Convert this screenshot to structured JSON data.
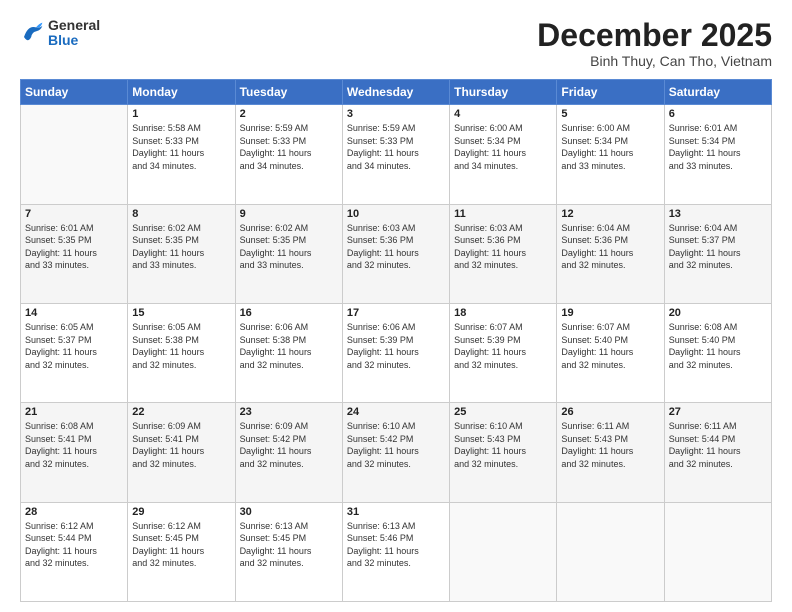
{
  "header": {
    "logo": {
      "general": "General",
      "blue": "Blue"
    },
    "title": "December 2025",
    "subtitle": "Binh Thuy, Can Tho, Vietnam"
  },
  "weekdays": [
    "Sunday",
    "Monday",
    "Tuesday",
    "Wednesday",
    "Thursday",
    "Friday",
    "Saturday"
  ],
  "weeks": [
    [
      {
        "day": "",
        "info": ""
      },
      {
        "day": "1",
        "info": "Sunrise: 5:58 AM\nSunset: 5:33 PM\nDaylight: 11 hours\nand 34 minutes."
      },
      {
        "day": "2",
        "info": "Sunrise: 5:59 AM\nSunset: 5:33 PM\nDaylight: 11 hours\nand 34 minutes."
      },
      {
        "day": "3",
        "info": "Sunrise: 5:59 AM\nSunset: 5:33 PM\nDaylight: 11 hours\nand 34 minutes."
      },
      {
        "day": "4",
        "info": "Sunrise: 6:00 AM\nSunset: 5:34 PM\nDaylight: 11 hours\nand 34 minutes."
      },
      {
        "day": "5",
        "info": "Sunrise: 6:00 AM\nSunset: 5:34 PM\nDaylight: 11 hours\nand 33 minutes."
      },
      {
        "day": "6",
        "info": "Sunrise: 6:01 AM\nSunset: 5:34 PM\nDaylight: 11 hours\nand 33 minutes."
      }
    ],
    [
      {
        "day": "7",
        "info": "Sunrise: 6:01 AM\nSunset: 5:35 PM\nDaylight: 11 hours\nand 33 minutes."
      },
      {
        "day": "8",
        "info": "Sunrise: 6:02 AM\nSunset: 5:35 PM\nDaylight: 11 hours\nand 33 minutes."
      },
      {
        "day": "9",
        "info": "Sunrise: 6:02 AM\nSunset: 5:35 PM\nDaylight: 11 hours\nand 33 minutes."
      },
      {
        "day": "10",
        "info": "Sunrise: 6:03 AM\nSunset: 5:36 PM\nDaylight: 11 hours\nand 32 minutes."
      },
      {
        "day": "11",
        "info": "Sunrise: 6:03 AM\nSunset: 5:36 PM\nDaylight: 11 hours\nand 32 minutes."
      },
      {
        "day": "12",
        "info": "Sunrise: 6:04 AM\nSunset: 5:36 PM\nDaylight: 11 hours\nand 32 minutes."
      },
      {
        "day": "13",
        "info": "Sunrise: 6:04 AM\nSunset: 5:37 PM\nDaylight: 11 hours\nand 32 minutes."
      }
    ],
    [
      {
        "day": "14",
        "info": "Sunrise: 6:05 AM\nSunset: 5:37 PM\nDaylight: 11 hours\nand 32 minutes."
      },
      {
        "day": "15",
        "info": "Sunrise: 6:05 AM\nSunset: 5:38 PM\nDaylight: 11 hours\nand 32 minutes."
      },
      {
        "day": "16",
        "info": "Sunrise: 6:06 AM\nSunset: 5:38 PM\nDaylight: 11 hours\nand 32 minutes."
      },
      {
        "day": "17",
        "info": "Sunrise: 6:06 AM\nSunset: 5:39 PM\nDaylight: 11 hours\nand 32 minutes."
      },
      {
        "day": "18",
        "info": "Sunrise: 6:07 AM\nSunset: 5:39 PM\nDaylight: 11 hours\nand 32 minutes."
      },
      {
        "day": "19",
        "info": "Sunrise: 6:07 AM\nSunset: 5:40 PM\nDaylight: 11 hours\nand 32 minutes."
      },
      {
        "day": "20",
        "info": "Sunrise: 6:08 AM\nSunset: 5:40 PM\nDaylight: 11 hours\nand 32 minutes."
      }
    ],
    [
      {
        "day": "21",
        "info": "Sunrise: 6:08 AM\nSunset: 5:41 PM\nDaylight: 11 hours\nand 32 minutes."
      },
      {
        "day": "22",
        "info": "Sunrise: 6:09 AM\nSunset: 5:41 PM\nDaylight: 11 hours\nand 32 minutes."
      },
      {
        "day": "23",
        "info": "Sunrise: 6:09 AM\nSunset: 5:42 PM\nDaylight: 11 hours\nand 32 minutes."
      },
      {
        "day": "24",
        "info": "Sunrise: 6:10 AM\nSunset: 5:42 PM\nDaylight: 11 hours\nand 32 minutes."
      },
      {
        "day": "25",
        "info": "Sunrise: 6:10 AM\nSunset: 5:43 PM\nDaylight: 11 hours\nand 32 minutes."
      },
      {
        "day": "26",
        "info": "Sunrise: 6:11 AM\nSunset: 5:43 PM\nDaylight: 11 hours\nand 32 minutes."
      },
      {
        "day": "27",
        "info": "Sunrise: 6:11 AM\nSunset: 5:44 PM\nDaylight: 11 hours\nand 32 minutes."
      }
    ],
    [
      {
        "day": "28",
        "info": "Sunrise: 6:12 AM\nSunset: 5:44 PM\nDaylight: 11 hours\nand 32 minutes."
      },
      {
        "day": "29",
        "info": "Sunrise: 6:12 AM\nSunset: 5:45 PM\nDaylight: 11 hours\nand 32 minutes."
      },
      {
        "day": "30",
        "info": "Sunrise: 6:13 AM\nSunset: 5:45 PM\nDaylight: 11 hours\nand 32 minutes."
      },
      {
        "day": "31",
        "info": "Sunrise: 6:13 AM\nSunset: 5:46 PM\nDaylight: 11 hours\nand 32 minutes."
      },
      {
        "day": "",
        "info": ""
      },
      {
        "day": "",
        "info": ""
      },
      {
        "day": "",
        "info": ""
      }
    ]
  ]
}
